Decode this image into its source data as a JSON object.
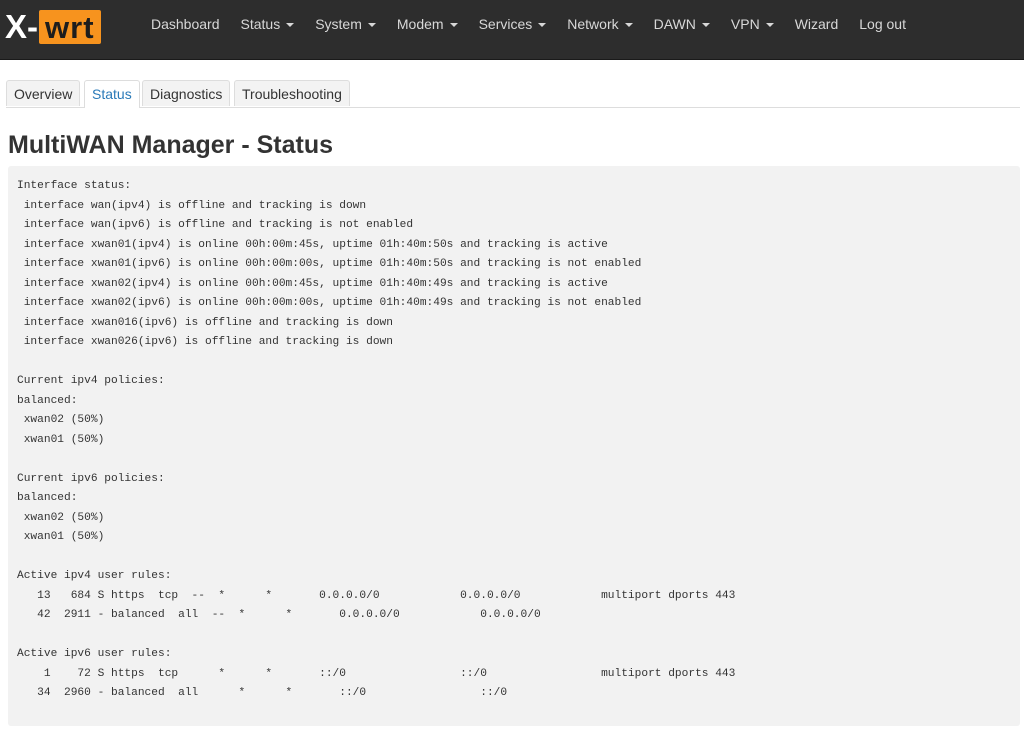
{
  "brand": {
    "x": "X",
    "dash": "-",
    "wrt": "wrt"
  },
  "nav": [
    {
      "label": "Dashboard",
      "dropdown": false
    },
    {
      "label": "Status",
      "dropdown": true
    },
    {
      "label": "System",
      "dropdown": true
    },
    {
      "label": "Modem",
      "dropdown": true
    },
    {
      "label": "Services",
      "dropdown": true
    },
    {
      "label": "Network",
      "dropdown": true
    },
    {
      "label": "DAWN",
      "dropdown": true
    },
    {
      "label": "VPN",
      "dropdown": true
    },
    {
      "label": "Wizard",
      "dropdown": false
    },
    {
      "label": "Log out",
      "dropdown": false
    }
  ],
  "tabs": [
    {
      "label": "Overview",
      "active": false
    },
    {
      "label": "Status",
      "active": true
    },
    {
      "label": "Diagnostics",
      "active": false
    },
    {
      "label": "Troubleshooting",
      "active": false
    }
  ],
  "page_title": "MultiWAN Manager - Status",
  "status_output": "Interface status:\n interface wan(ipv4) is offline and tracking is down\n interface wan(ipv6) is offline and tracking is not enabled\n interface xwan01(ipv4) is online 00h:00m:45s, uptime 01h:40m:50s and tracking is active\n interface xwan01(ipv6) is online 00h:00m:00s, uptime 01h:40m:50s and tracking is not enabled\n interface xwan02(ipv4) is online 00h:00m:45s, uptime 01h:40m:49s and tracking is active\n interface xwan02(ipv6) is online 00h:00m:00s, uptime 01h:40m:49s and tracking is not enabled\n interface xwan016(ipv6) is offline and tracking is down\n interface xwan026(ipv6) is offline and tracking is down\n\nCurrent ipv4 policies:\nbalanced:\n xwan02 (50%)\n xwan01 (50%)\n\nCurrent ipv6 policies:\nbalanced:\n xwan02 (50%)\n xwan01 (50%)\n\nActive ipv4 user rules:\n   13   684 S https  tcp  --  *      *       0.0.0.0/0            0.0.0.0/0            multiport dports 443\n   42  2911 - balanced  all  --  *      *       0.0.0.0/0            0.0.0.0/0\n\nActive ipv6 user rules:\n    1    72 S https  tcp      *      *       ::/0                 ::/0                 multiport dports 443\n   34  2960 - balanced  all      *      *       ::/0                 ::/0",
  "colors": {
    "navbar_bg": "#2d2d2d",
    "brand_accent": "#f7931e",
    "active_tab_text": "#2a7ab8",
    "status_box_bg": "#f2f2f2"
  }
}
